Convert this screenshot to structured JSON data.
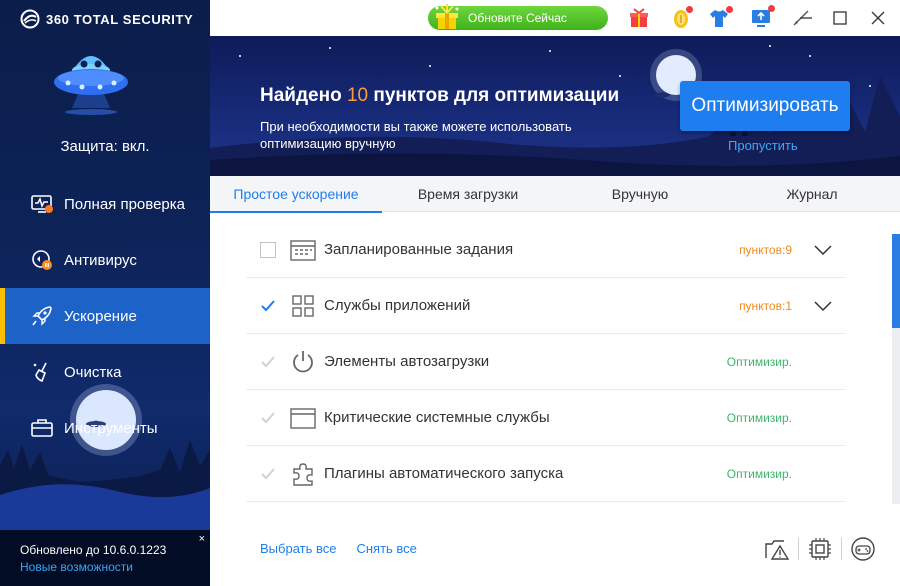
{
  "app": {
    "brand": "360 TOTAL SECURITY",
    "protection_status": "Защита: вкл."
  },
  "topbar": {
    "update_label": "Обновите Сейчас",
    "icons": [
      "gift-icon",
      "medal-icon",
      "tshirt-icon",
      "monitor-upload-icon",
      "theme-icon"
    ],
    "window_controls": [
      "minimize-icon",
      "maximize-icon",
      "close-icon"
    ]
  },
  "sidebar": {
    "items": [
      {
        "label": "Полная проверка",
        "icon": "full-scan-icon",
        "active": false
      },
      {
        "label": "Антивирус",
        "icon": "antivirus-icon",
        "active": false
      },
      {
        "label": "Ускорение",
        "icon": "rocket-icon",
        "active": true
      },
      {
        "label": "Очистка",
        "icon": "broom-icon",
        "active": false
      },
      {
        "label": "Инструменты",
        "icon": "toolbox-icon",
        "active": false
      }
    ],
    "footer": {
      "version": "Обновлено до 10.6.0.1223",
      "news": "Новые возможности",
      "close": "×"
    }
  },
  "banner": {
    "title_prefix": "Найдено",
    "title_count": "10",
    "title_suffix": "пунктов для оптимизации",
    "subtitle": "При необходимости вы также можете использовать оптимизацию вручную",
    "optimize_button": "Оптимизировать",
    "skip_link": "Пропустить"
  },
  "tabs": [
    {
      "label": "Простое ускорение",
      "active": true
    },
    {
      "label": "Время загрузки",
      "active": false
    },
    {
      "label": "Вручную",
      "active": false
    },
    {
      "label": "Журнал",
      "active": false
    }
  ],
  "rows": [
    {
      "label": "Запланированные задания",
      "status": "пунктов:9",
      "status_type": "orange",
      "checked": false,
      "expandable": true,
      "icon": "calendar-icon"
    },
    {
      "label": "Службы приложений",
      "status": "пунктов:1",
      "status_type": "orange",
      "checked": true,
      "expandable": true,
      "icon": "grid-icon"
    },
    {
      "label": "Элементы автозагрузки",
      "status": "Оптимизир.",
      "status_type": "green",
      "checked": true,
      "expandable": false,
      "icon": "power-icon"
    },
    {
      "label": "Критические системные службы",
      "status": "Оптимизир.",
      "status_type": "green",
      "checked": true,
      "expandable": false,
      "icon": "window-icon"
    },
    {
      "label": "Плагины автоматического запуска",
      "status": "Оптимизир.",
      "status_type": "green",
      "checked": true,
      "expandable": false,
      "icon": "puzzle-icon"
    }
  ],
  "bottom": {
    "select_all": "Выбрать все",
    "deselect_all": "Снять все",
    "icons": [
      "warning-icon",
      "chip-icon",
      "gamepad-icon"
    ]
  },
  "colors": {
    "accent": "#1e7ef0",
    "sidebar_bg": "#0d2358",
    "active_marker": "#ffbf00",
    "status_orange": "#f08a1c",
    "status_green": "#3ab56a",
    "update_green": "#4cbf23"
  }
}
